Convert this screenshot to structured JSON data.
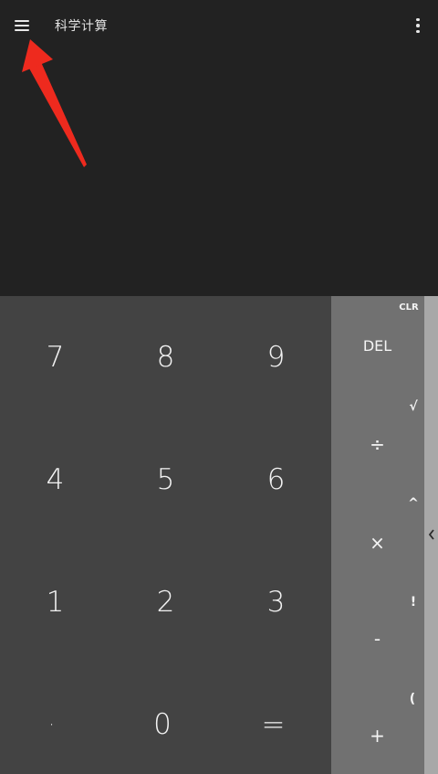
{
  "app_bar": {
    "menu_icon": "hamburger-menu-icon",
    "title": "科学计算",
    "overflow_icon": "more-vertical-icon"
  },
  "annotation": {
    "color": "#ee2a1e",
    "points_to": "menu-button"
  },
  "numpad": {
    "keys": [
      "7",
      "8",
      "9",
      "4",
      "5",
      "6",
      "1",
      "2",
      "3",
      "·",
      "0",
      "="
    ]
  },
  "operators": {
    "clr": "CLR",
    "del": "DEL",
    "sqrt": "√",
    "divide": "÷",
    "power": "^",
    "multiply": "×",
    "factorial": "!",
    "minus": "-",
    "paren": "(",
    "plus": "+"
  },
  "drawer": {
    "handle_icon": "chevron-left-icon"
  },
  "colors": {
    "display_bg": "#222222",
    "numpad_bg": "#434343",
    "ops_bg": "#717171",
    "drawer_bg": "#a8a8a8",
    "text": "#f2f2f2"
  }
}
